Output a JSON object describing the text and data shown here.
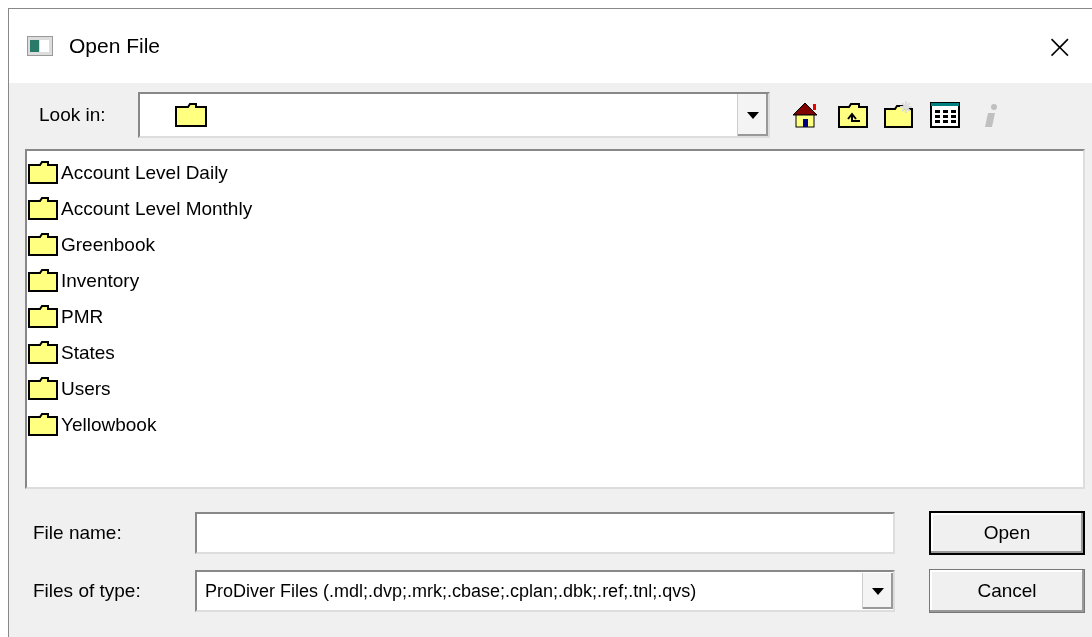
{
  "window": {
    "title": "Open File",
    "close": "×"
  },
  "look_in": {
    "label": "Look in:"
  },
  "toolbar": [
    {
      "kind": "home",
      "disabled": false
    },
    {
      "kind": "up",
      "disabled": false
    },
    {
      "kind": "newfolder",
      "disabled": false
    },
    {
      "kind": "details",
      "disabled": false
    },
    {
      "kind": "info",
      "disabled": true
    }
  ],
  "files": [
    {
      "name": "Account Level Daily"
    },
    {
      "name": "Account Level Monthly"
    },
    {
      "name": "Greenbook"
    },
    {
      "name": "Inventory"
    },
    {
      "name": "PMR"
    },
    {
      "name": "States"
    },
    {
      "name": "Users"
    },
    {
      "name": "Yellowbook"
    }
  ],
  "file_name": {
    "label": "File name:"
  },
  "file_type": {
    "label": "Files of type:",
    "value": "ProDiver Files (.mdl;.dvp;.mrk;.cbase;.cplan;.dbk;.ref;.tnl;.qvs)"
  },
  "buttons": [
    {
      "label": "Open",
      "default": true
    },
    {
      "label": "Cancel",
      "default": false
    }
  ]
}
